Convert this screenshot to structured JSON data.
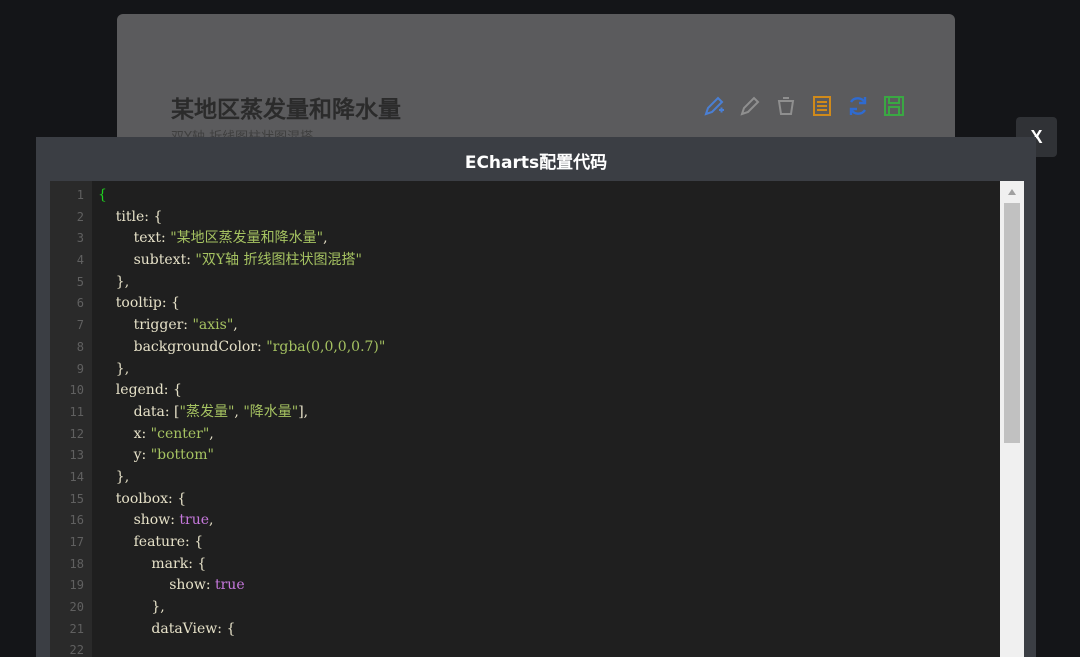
{
  "chart": {
    "title": "某地区蒸发量和降水量",
    "subtitle": "双Y轴 折线图柱状图混搭",
    "toolbox": [
      {
        "icon": "mark-icon",
        "color": "#4a7fd4"
      },
      {
        "icon": "mark-undo-icon",
        "color": "#a0a0a0"
      },
      {
        "icon": "mark-clear-icon",
        "color": "#a0a0a0"
      },
      {
        "icon": "data-view-icon",
        "color": "#d08a1a"
      },
      {
        "icon": "restore-icon",
        "color": "#2f6bd0"
      },
      {
        "icon": "save-image-icon",
        "color": "#3aa843"
      }
    ]
  },
  "modal": {
    "title": "ECharts配置代码",
    "close_label": "X"
  },
  "editor": {
    "line_numbers": [
      "1",
      "2",
      "3",
      "4",
      "5",
      "6",
      "7",
      "8",
      "9",
      "10",
      "11",
      "12",
      "13",
      "14",
      "15",
      "16",
      "17",
      "18",
      "19",
      "20",
      "21",
      "22"
    ],
    "lines": [
      [
        {
          "t": "{",
          "c": "brace-open"
        }
      ],
      [
        {
          "t": "    title: {",
          "c": "k"
        }
      ],
      [
        {
          "t": "        text: ",
          "c": "k"
        },
        {
          "t": "\"某地区蒸发量和降水量\"",
          "c": "s"
        },
        {
          "t": ",",
          "c": "p"
        }
      ],
      [
        {
          "t": "        subtext: ",
          "c": "k"
        },
        {
          "t": "\"双Y轴 折线图柱状图混搭\"",
          "c": "s"
        }
      ],
      [
        {
          "t": "    },",
          "c": "k"
        }
      ],
      [
        {
          "t": "    tooltip: {",
          "c": "k"
        }
      ],
      [
        {
          "t": "        trigger: ",
          "c": "k"
        },
        {
          "t": "\"axis\"",
          "c": "s"
        },
        {
          "t": ",",
          "c": "p"
        }
      ],
      [
        {
          "t": "        backgroundColor: ",
          "c": "k"
        },
        {
          "t": "\"rgba(0,0,0,0.7)\"",
          "c": "s"
        }
      ],
      [
        {
          "t": "    },",
          "c": "k"
        }
      ],
      [
        {
          "t": "    legend: {",
          "c": "k"
        }
      ],
      [
        {
          "t": "        data: [",
          "c": "k"
        },
        {
          "t": "\"蒸发量\"",
          "c": "s"
        },
        {
          "t": ", ",
          "c": "p"
        },
        {
          "t": "\"降水量\"",
          "c": "s"
        },
        {
          "t": "],",
          "c": "p"
        }
      ],
      [
        {
          "t": "        x: ",
          "c": "k"
        },
        {
          "t": "\"center\"",
          "c": "s"
        },
        {
          "t": ",",
          "c": "p"
        }
      ],
      [
        {
          "t": "        y: ",
          "c": "k"
        },
        {
          "t": "\"bottom\"",
          "c": "s"
        }
      ],
      [
        {
          "t": "    },",
          "c": "k"
        }
      ],
      [
        {
          "t": "    toolbox: {",
          "c": "k"
        }
      ],
      [
        {
          "t": "        show: ",
          "c": "k"
        },
        {
          "t": "true",
          "c": "b"
        },
        {
          "t": ",",
          "c": "p"
        }
      ],
      [
        {
          "t": "        feature: {",
          "c": "k"
        }
      ],
      [
        {
          "t": "            mark: {",
          "c": "k"
        }
      ],
      [
        {
          "t": "                show: ",
          "c": "k"
        },
        {
          "t": "true",
          "c": "b"
        }
      ],
      [
        {
          "t": "            },",
          "c": "k"
        }
      ],
      [
        {
          "t": "            dataView: {",
          "c": "k"
        }
      ],
      [
        {
          "t": "",
          "c": "k"
        }
      ]
    ]
  }
}
